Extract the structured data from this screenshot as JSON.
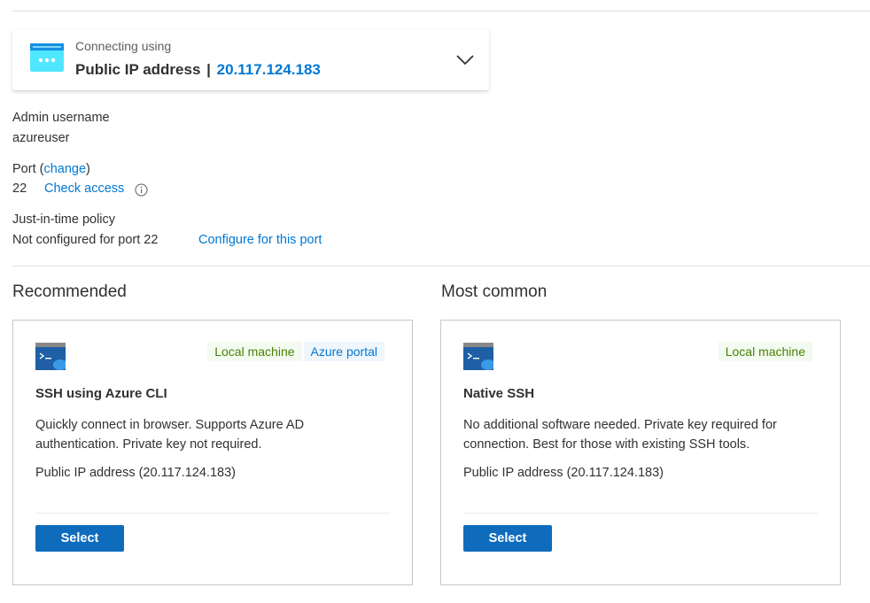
{
  "connection": {
    "label": "Connecting using",
    "method": "Public IP address",
    "separator": "|",
    "ip": "20.117.124.183",
    "icon": "network-icon"
  },
  "admin": {
    "label": "Admin username",
    "value": "azureuser"
  },
  "port": {
    "label_prefix": "Port (",
    "change_link": "change",
    "label_suffix": ")",
    "value": "22",
    "check_access": "Check access",
    "info_icon": "info-icon"
  },
  "jit": {
    "label": "Just-in-time policy",
    "value": "Not configured for port 22",
    "configure_link": "Configure for this port"
  },
  "sections": {
    "recommended": "Recommended",
    "most_common": "Most common"
  },
  "cards": [
    {
      "icon": "terminal-icon",
      "badges": [
        "Local machine",
        "Azure portal"
      ],
      "title": "SSH using Azure CLI",
      "description": "Quickly connect in browser. Supports Azure AD authentication. Private key not required.",
      "ip_line": "Public IP address (20.117.124.183)",
      "button": "Select"
    },
    {
      "icon": "terminal-icon",
      "badges": [
        "Local machine"
      ],
      "title": "Native SSH",
      "description": "No additional software needed. Private key required for connection. Best for those with existing SSH tools.",
      "ip_line": "Public IP address (20.117.124.183)",
      "button": "Select"
    }
  ],
  "colors": {
    "accent": "#0078d4",
    "button": "#0f6cbd",
    "local_badge_bg": "#f3faf0",
    "local_badge_text": "#498205",
    "portal_badge_bg": "#eff6fc"
  }
}
